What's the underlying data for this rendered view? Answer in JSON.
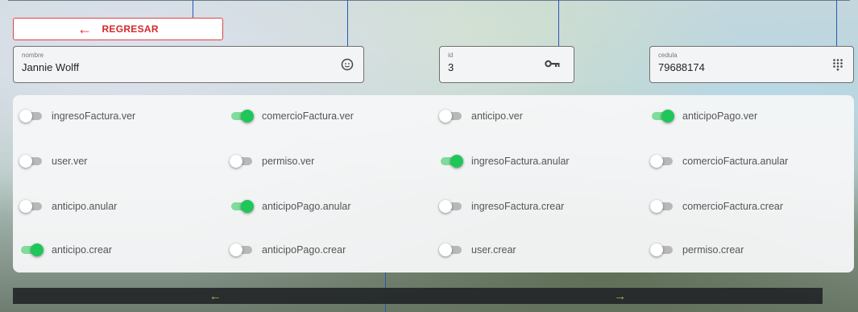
{
  "back_button": {
    "label": "REGRESAR",
    "icon": "arrow-left-icon",
    "color": "#d42a2a"
  },
  "fields": {
    "nombre": {
      "label": "nombre",
      "value": "Jannie Wolff",
      "icon": "user-circle-icon"
    },
    "id": {
      "label": "id",
      "value": "3",
      "icon": "key-icon"
    },
    "cedula": {
      "label": "cedula",
      "value": "79688174",
      "icon": "dialpad-icon"
    }
  },
  "permissions": [
    {
      "label": "ingresoFactura.ver",
      "on": false
    },
    {
      "label": "comercioFactura.ver",
      "on": true
    },
    {
      "label": "anticipo.ver",
      "on": false
    },
    {
      "label": "anticipoPago.ver",
      "on": true
    },
    {
      "label": "user.ver",
      "on": false
    },
    {
      "label": "permiso.ver",
      "on": false
    },
    {
      "label": "ingresoFactura.anular",
      "on": true
    },
    {
      "label": "comercioFactura.anular",
      "on": false
    },
    {
      "label": "anticipo.anular",
      "on": false
    },
    {
      "label": "anticipoPago.anular",
      "on": true
    },
    {
      "label": "ingresoFactura.crear",
      "on": false
    },
    {
      "label": "comercioFactura.crear",
      "on": false
    },
    {
      "label": "anticipo.crear",
      "on": true
    },
    {
      "label": "anticipoPago.crear",
      "on": false
    },
    {
      "label": "user.crear",
      "on": false
    },
    {
      "label": "permiso.crear",
      "on": false
    }
  ],
  "nav": {
    "prev": "←",
    "next": "→",
    "accent": "#8bc34a"
  },
  "colors": {
    "toggle_on": "#1fc65a",
    "toggle_track_on": "#7fdc9a",
    "toggle_off": "#b8b8b8"
  }
}
